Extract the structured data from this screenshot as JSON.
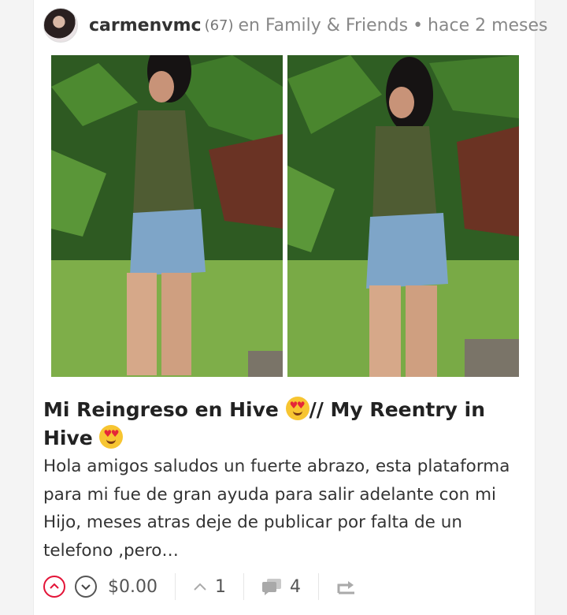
{
  "header": {
    "author": "carmenvmc",
    "reputation": "(67)",
    "community_prefix": "en",
    "community": "Family & Friends",
    "separator": "•",
    "timestamp": "hace 2 meses"
  },
  "post": {
    "title_part1": "Mi Reingreso en Hive",
    "title_part2": "// My Reentry in Hive",
    "excerpt": "Hola amigos saludos un fuerte abrazo, esta plataforma para mi fue de gran ayuda para salir adelante con mi Hijo, meses atras deje de publicar por falta de un telefono ,pero…"
  },
  "footer": {
    "payout": "$0.00",
    "votes": "1",
    "comments": "4"
  },
  "icons": {
    "upvote": "upvote-icon",
    "downvote": "downvote-icon",
    "votes": "chevron-up-icon",
    "comments": "comments-icon",
    "reblog": "reblog-icon"
  },
  "colors": {
    "accent": "#e31337"
  }
}
